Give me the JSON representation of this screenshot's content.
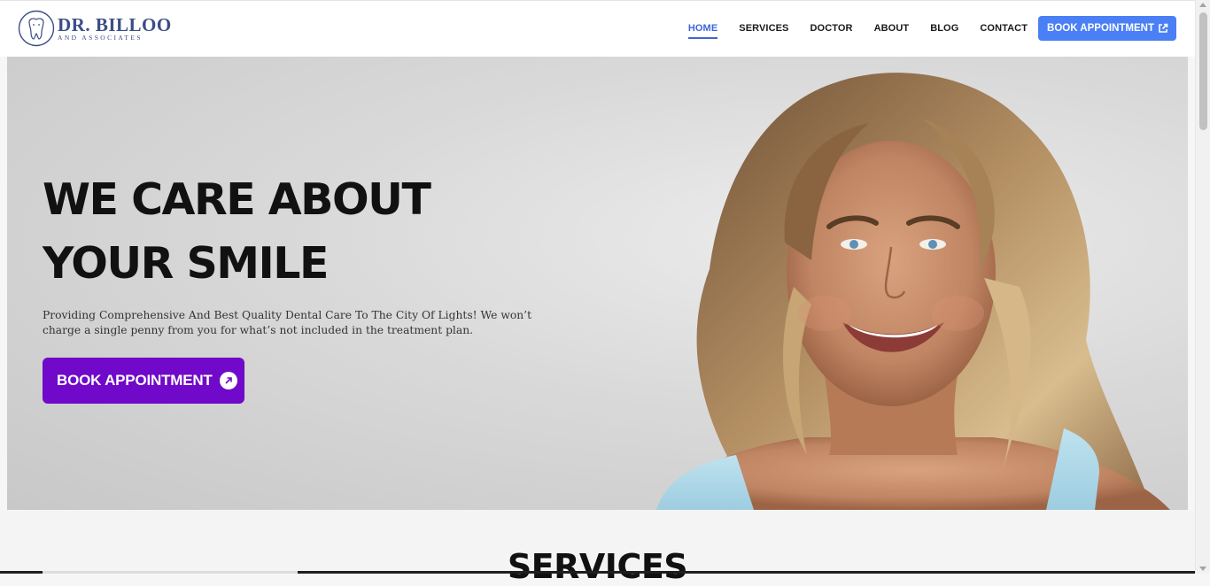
{
  "brand": {
    "title": "DR. BILLOO",
    "subtitle": "AND ASSOCIATES",
    "color": "#3a4d86",
    "logo_icon": "tooth-icon"
  },
  "nav": {
    "items": [
      {
        "label": "HOME",
        "active": true
      },
      {
        "label": "SERVICES",
        "active": false
      },
      {
        "label": "DOCTOR",
        "active": false
      },
      {
        "label": "ABOUT",
        "active": false
      },
      {
        "label": "BLOG",
        "active": false
      },
      {
        "label": "CONTACT",
        "active": false
      }
    ],
    "cta_label": "BOOK APPOINTMENT",
    "cta_icon": "external-link-icon",
    "accent": "#4a7ff5"
  },
  "hero": {
    "title_line1": "WE CARE ABOUT",
    "title_line2": "YOUR SMILE",
    "description": "Providing Comprehensive And Best Quality Dental Care To The City Of Lights! We won’t charge a single penny from you for what’s not included in the treatment plan.",
    "cta_label": "BOOK APPOINTMENT",
    "cta_icon": "arrow-up-right-icon",
    "cta_color": "#7009c9",
    "image": "smiling-woman-photo"
  },
  "services": {
    "title": "SERVICES"
  }
}
